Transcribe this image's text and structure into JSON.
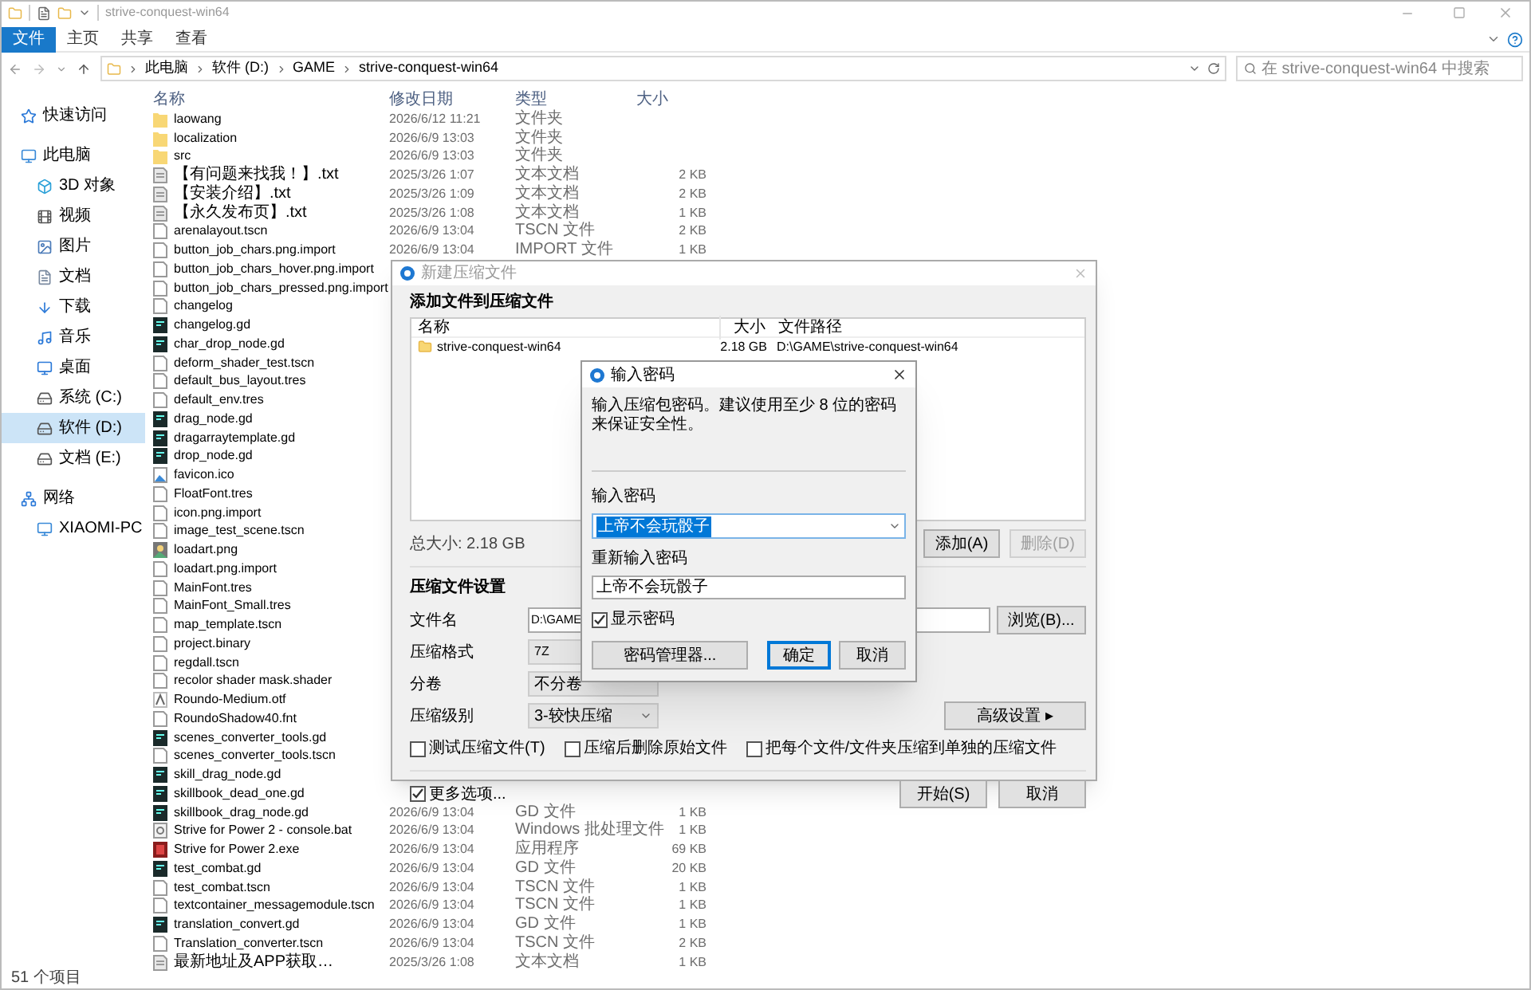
{
  "window": {
    "title": "strive-conquest-win64"
  },
  "ribbon_tabs": [
    {
      "label": "文件",
      "selected": true
    },
    {
      "label": "主页",
      "selected": false
    },
    {
      "label": "共享",
      "selected": false
    },
    {
      "label": "查看",
      "selected": false
    }
  ],
  "address": {
    "crumbs": [
      "此电脑",
      "软件 (D:)",
      "GAME",
      "strive-conquest-win64"
    ]
  },
  "search": {
    "placeholder": "在 strive-conquest-win64 中搜索"
  },
  "sidebar": {
    "items": [
      {
        "label": "快速访问",
        "kind": "star",
        "selected": false
      },
      {
        "label": "此电脑",
        "kind": "computer",
        "selected": false,
        "children": [
          {
            "label": "3D 对象",
            "kind": "cube",
            "selected": false
          },
          {
            "label": "视频",
            "kind": "film",
            "selected": false
          },
          {
            "label": "图片",
            "kind": "picture",
            "selected": false
          },
          {
            "label": "文档",
            "kind": "document",
            "selected": false
          },
          {
            "label": "下载",
            "kind": "download",
            "selected": false
          },
          {
            "label": "音乐",
            "kind": "music",
            "selected": false
          },
          {
            "label": "桌面",
            "kind": "desktop",
            "selected": false
          },
          {
            "label": "系统 (C:)",
            "kind": "drive",
            "selected": false
          },
          {
            "label": "软件 (D:)",
            "kind": "drive",
            "selected": true
          },
          {
            "label": "文档 (E:)",
            "kind": "drive",
            "selected": false
          }
        ]
      },
      {
        "label": "网络",
        "kind": "network",
        "selected": false,
        "children": [
          {
            "label": "XIAOMI-PC",
            "kind": "computer",
            "selected": false
          }
        ]
      }
    ]
  },
  "file_list": {
    "columns": [
      "名称",
      "修改日期",
      "类型",
      "大小"
    ],
    "rows": [
      {
        "name": "laowang",
        "kind": "folder",
        "date": "2026/6/12 11:21",
        "type": "文件夹"
      },
      {
        "name": "localization",
        "kind": "folder",
        "date": "2026/6/9 13:03",
        "type": "文件夹"
      },
      {
        "name": "src",
        "kind": "folder",
        "date": "2026/6/9 13:03",
        "type": "文件夹"
      },
      {
        "name": "【有问题来找我！】.txt",
        "kind": "text",
        "date": "2025/3/26 1:07",
        "type": "文本文档",
        "size": "2 KB"
      },
      {
        "name": "【安装介绍】.txt",
        "kind": "text",
        "date": "2025/3/26 1:09",
        "type": "文本文档",
        "size": "2 KB"
      },
      {
        "name": "【永久发布页】.txt",
        "kind": "text",
        "date": "2025/3/26 1:08",
        "type": "文本文档",
        "size": "1 KB"
      },
      {
        "name": "arenalayout.tscn",
        "kind": "file",
        "date": "2026/6/9 13:04",
        "type": "TSCN 文件",
        "size": "2 KB"
      },
      {
        "name": "button_job_chars.png.import",
        "kind": "file",
        "date": "2026/6/9 13:04",
        "type": "IMPORT 文件",
        "size": "1 KB"
      },
      {
        "name": "button_job_chars_hover.png.import",
        "kind": "file"
      },
      {
        "name": "button_job_chars_pressed.png.import",
        "kind": "file"
      },
      {
        "name": "changelog",
        "kind": "file"
      },
      {
        "name": "changelog.gd",
        "kind": "gd"
      },
      {
        "name": "char_drop_node.gd",
        "kind": "gd"
      },
      {
        "name": "deform_shader_test.tscn",
        "kind": "file"
      },
      {
        "name": "default_bus_layout.tres",
        "kind": "file"
      },
      {
        "name": "default_env.tres",
        "kind": "file"
      },
      {
        "name": "drag_node.gd",
        "kind": "gd"
      },
      {
        "name": "dragarraytemplate.gd",
        "kind": "gd"
      },
      {
        "name": "drop_node.gd",
        "kind": "gd"
      },
      {
        "name": "favicon.ico",
        "kind": "icon"
      },
      {
        "name": "FloatFont.tres",
        "kind": "file"
      },
      {
        "name": "icon.png.import",
        "kind": "file"
      },
      {
        "name": "image_test_scene.tscn",
        "kind": "file"
      },
      {
        "name": "loadart.png",
        "kind": "image"
      },
      {
        "name": "loadart.png.import",
        "kind": "file"
      },
      {
        "name": "MainFont.tres",
        "kind": "file"
      },
      {
        "name": "MainFont_Small.tres",
        "kind": "file"
      },
      {
        "name": "map_template.tscn",
        "kind": "file"
      },
      {
        "name": "project.binary",
        "kind": "file"
      },
      {
        "name": "regdall.tscn",
        "kind": "file"
      },
      {
        "name": "recolor shader mask.shader",
        "kind": "file"
      },
      {
        "name": "Roundo-Medium.otf",
        "kind": "font"
      },
      {
        "name": "RoundoShadow40.fnt",
        "kind": "file"
      },
      {
        "name": "scenes_converter_tools.gd",
        "kind": "gd"
      },
      {
        "name": "scenes_converter_tools.tscn",
        "kind": "file"
      },
      {
        "name": "skill_drag_node.gd",
        "kind": "gd"
      },
      {
        "name": "skillbook_dead_one.gd",
        "kind": "gd"
      },
      {
        "name": "skillbook_drag_node.gd",
        "kind": "gd",
        "date": "2026/6/9 13:04",
        "type": "GD 文件",
        "size": "1 KB"
      },
      {
        "name": "Strive for Power 2 - console.bat",
        "kind": "bat",
        "date": "2026/6/9 13:04",
        "type": "Windows 批处理文件",
        "size": "1 KB"
      },
      {
        "name": "Strive for Power 2.exe",
        "kind": "exe",
        "date": "2026/6/9 13:04",
        "type": "应用程序",
        "size": "69 KB"
      },
      {
        "name": "test_combat.gd",
        "kind": "gd",
        "date": "2026/6/9 13:04",
        "type": "GD 文件",
        "size": "20 KB"
      },
      {
        "name": "test_combat.tscn",
        "kind": "file",
        "date": "2026/6/9 13:04",
        "type": "TSCN 文件",
        "size": "1 KB"
      },
      {
        "name": "textcontainer_messagemodule.tscn",
        "kind": "file",
        "date": "2026/6/9 13:04",
        "type": "TSCN 文件",
        "size": "1 KB"
      },
      {
        "name": "translation_convert.gd",
        "kind": "gd",
        "date": "2026/6/9 13:04",
        "type": "GD 文件",
        "size": "1 KB"
      },
      {
        "name": "Translation_converter.tscn",
        "kind": "file",
        "date": "2026/6/9 13:04",
        "type": "TSCN 文件",
        "size": "2 KB"
      },
      {
        "name": "最新地址及APP获取…",
        "kind": "text",
        "date": "2025/3/26 1:08",
        "type": "文本文档",
        "size": "1 KB"
      }
    ]
  },
  "status_bar": {
    "count": "51 个项目"
  },
  "archive_dialog": {
    "title": "新建压缩文件",
    "heading": "添加文件到压缩文件",
    "list_columns": [
      "名称",
      "大小",
      "文件路径"
    ],
    "list_rows": [
      {
        "name": "strive-conquest-win64",
        "size": "2.18 GB",
        "path": "D:\\GAME\\strive-conquest-win64"
      }
    ],
    "total": "总大小: 2.18 GB",
    "add_button": {
      "label": "添加(A)",
      "disabled": false
    },
    "remove_button": {
      "label": "删除(D)",
      "disabled": true
    },
    "settings_heading": "压缩文件设置",
    "filename_label": "文件名",
    "filename_value": "D:\\GAME",
    "browse_button": "浏览(B)...",
    "format_label": "压缩格式",
    "format_value": "7Z",
    "split_label": "分卷",
    "split_value": "不分卷",
    "level_label": "压缩级别",
    "level_value": "3-较快压缩",
    "advanced_button": "高级设置 ▸",
    "options": [
      {
        "label": "测试压缩文件(T)",
        "checked": false
      },
      {
        "label": "压缩后删除原始文件",
        "checked": false
      },
      {
        "label": "把每个文件/文件夹压缩到单独的压缩文件",
        "checked": false
      }
    ],
    "more_options": {
      "label": "更多选项...",
      "checked": true
    },
    "start_button": "开始(S)",
    "cancel_button": "取消"
  },
  "password_dialog": {
    "title": "输入密码",
    "message": "输入压缩包密码。建议使用至少 8 位的密码来保证安全性。",
    "password_label": "输入密码",
    "password_value": "上帝不会玩骰子",
    "confirm_label": "重新输入密码",
    "confirm_value": "上帝不会玩骰子",
    "show_password": {
      "label": "显示密码",
      "checked": true
    },
    "manager_button": "密码管理器...",
    "ok_button": "确定",
    "cancel_button": "取消"
  }
}
